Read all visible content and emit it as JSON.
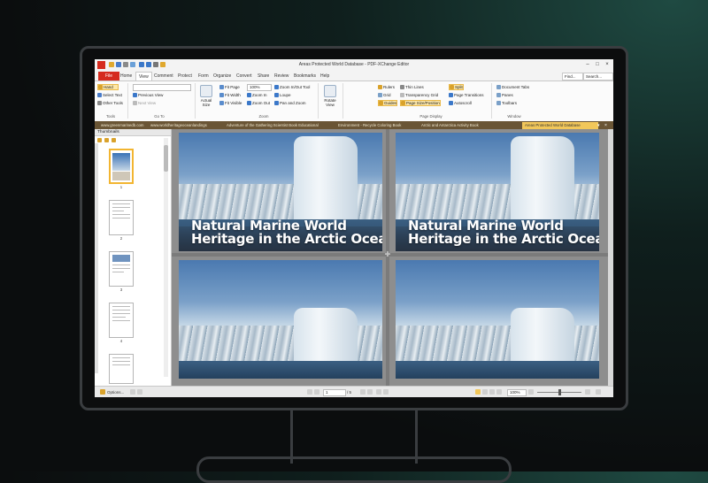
{
  "window": {
    "title": "Areas Protected World Database - PDF-XChange Editor"
  },
  "ribbon_tabs": [
    "File",
    "Home",
    "View",
    "Comment",
    "Protect",
    "Form",
    "Organize",
    "Convert",
    "Share",
    "Review",
    "Bookmarks",
    "Help"
  ],
  "active_ribbon_tab": "View",
  "find_label": "Find...",
  "search_label": "Search...",
  "ribbon": {
    "tools_group": {
      "label": "Tools",
      "hand": "Hand",
      "select_text": "Select Text",
      "other_tools": "Other Tools"
    },
    "goto_group": {
      "label": "Go To",
      "previous_view": "Previous View",
      "next_view": "Next View"
    },
    "actual_size": "Actual Size",
    "fit_page": "Fit Page",
    "fit_width": "Fit Width",
    "fit_visible": "Fit Visible",
    "zoom_value": "100%",
    "zoom_in": "Zoom In",
    "zoom_out": "Zoom Out",
    "zoom_inout_tool": "Zoom In/Out Tool",
    "loupe": "Loupe",
    "pan_zoom": "Pan and Zoom",
    "zoom_group_label": "Zoom",
    "rotate_view": "Rotate View",
    "rulers": "Rulers",
    "grid": "Grid",
    "guides": "Guides",
    "thin_lines": "Thin Lines",
    "transparency_grid": "Transparency Grid",
    "page_size_position": "Page Size/Position",
    "split": "Split",
    "page_transitions": "Page Transitions",
    "autoscroll": "Autoscroll",
    "page_display_label": "Page Display",
    "document_tabs": "Document Tabs",
    "panes": "Panes",
    "toolbars": "Toolbars",
    "window_label": "Window"
  },
  "document_tabs": [
    "www.greenmarinedb.com",
    "www.worldheritageoceanlandings",
    "Adventure of the Gathering Scientist Book Educational",
    "Environment - Recycle Coloring Book",
    "Arctic and Antarctica Activity Book",
    "Areas Protected World Database"
  ],
  "active_document_tab": 5,
  "thumbnails_pane": {
    "title": "Thumbnails",
    "pages": [
      "1",
      "2",
      "3",
      "4",
      "5"
    ]
  },
  "document": {
    "heading_line1": "Natural Marine World",
    "heading_line2": "Heritage in the Arctic Ocean"
  },
  "statusbar": {
    "options": "Options...",
    "page_current": "1",
    "page_total": "/ 5",
    "zoom": "100%",
    "zoom_box": "100%"
  },
  "colors": {
    "brand_red": "#d52b1e",
    "accent_yellow": "#f2c75a",
    "doc_tab_bar": "#6a5535"
  }
}
